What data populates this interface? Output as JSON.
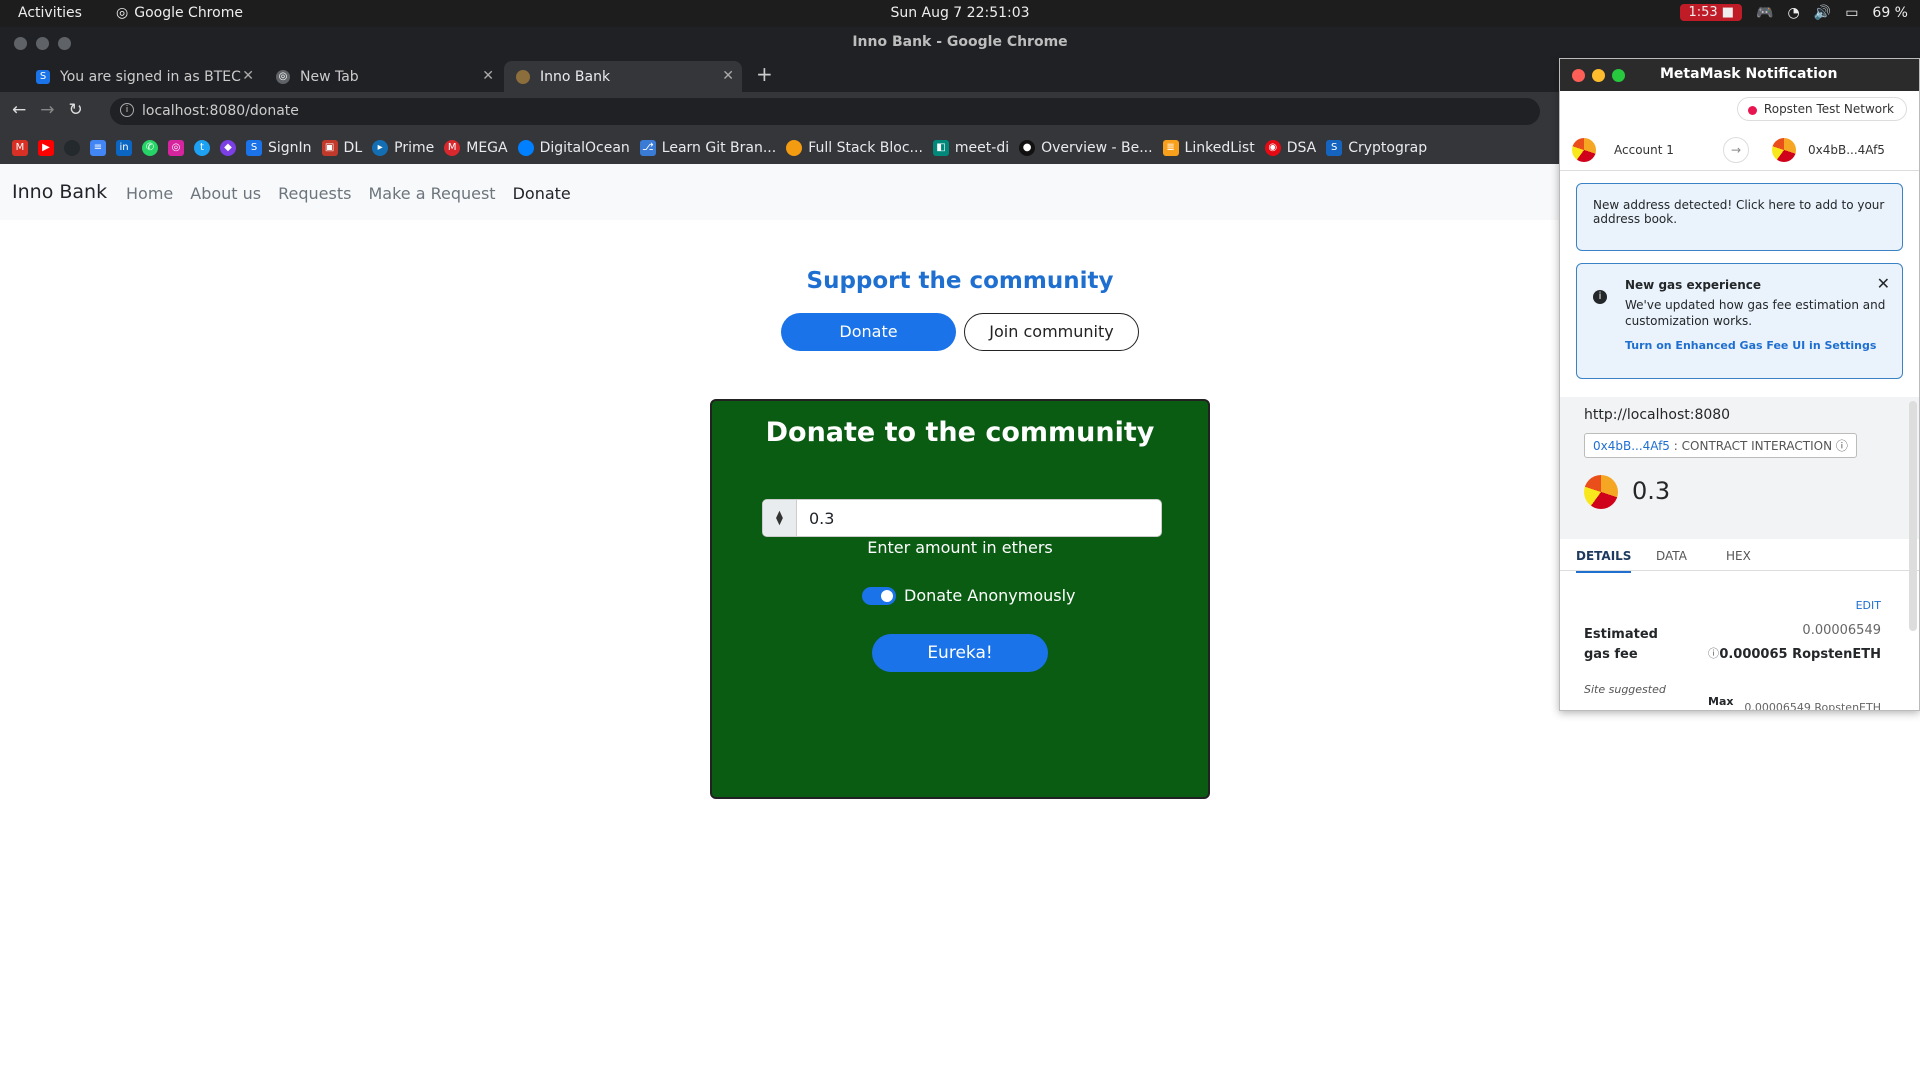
{
  "system": {
    "activities": "Activities",
    "app": "Google Chrome",
    "clock": "Sun Aug 7  22:51:03",
    "rec": "1:53",
    "battery": "69 %"
  },
  "window": {
    "title": "Inno Bank - Google Chrome"
  },
  "tabs": [
    {
      "label": "You are signed in as BTEC",
      "icon": "S"
    },
    {
      "label": "New Tab",
      "icon": "chrome"
    },
    {
      "label": "Inno Bank",
      "icon": "dot"
    }
  ],
  "address": {
    "url": "localhost:8080/donate"
  },
  "bookmarks": [
    "SignIn",
    "DL",
    "Prime",
    "MEGA",
    "DigitalOcean",
    "Learn Git Bran...",
    "Full Stack Bloc...",
    "meet-di",
    "Overview - Be...",
    "LinkedList",
    "DSA",
    "Cryptograp"
  ],
  "site": {
    "brand": "Inno Bank",
    "nav": [
      "Home",
      "About us",
      "Requests",
      "Make a Request",
      "Donate"
    ],
    "heading": "Support the community",
    "donate_btn": "Donate",
    "join_btn": "Join community",
    "card": {
      "title": "Donate to the community",
      "eth_symbol": "⧫",
      "amount": "0.3",
      "hint": "Enter amount in ethers",
      "toggle_label": "Donate Anonymously",
      "toggle_on": true,
      "submit": "Eureka!"
    }
  },
  "metamask": {
    "title": "MetaMask Notification",
    "network": "Ropsten Test Network",
    "account": "Account 1",
    "to_address": "0x4bB...4Af5",
    "notice1": "New address detected! Click here to add to your address book.",
    "notice2_title": "New gas experience",
    "notice2_body": "We've updated how gas fee estimation and customization works.",
    "notice2_link": "Turn on Enhanced Gas Fee UI in Settings",
    "origin": "http://localhost:8080",
    "contract_addr": "0x4bB...4Af5",
    "contract_label": ": CONTRACT INTERACTION",
    "amount": "0.3",
    "tab_details": "DETAILS",
    "tab_data": "DATA",
    "tab_hex": "HEX",
    "edit": "EDIT",
    "gas_label": "Estimated gas fee",
    "gas_small": "0.00006549",
    "gas_main": "0.000065 RopstenETH",
    "site_suggested": "Site suggested",
    "max_label": "Max",
    "max_value": "0.00006549 RopstenETH"
  }
}
